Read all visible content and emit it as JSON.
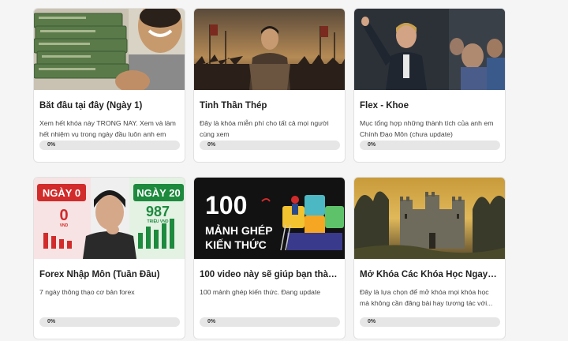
{
  "courses": [
    {
      "title": "Bắt đầu tại đây (Ngày 1)",
      "description": "Xem hết khóa này TRONG NAY. Xem và làm hết nhiệm vụ trong ngày đầu luôn anh em",
      "progress": 0,
      "progress_label": "0%",
      "thumbnail": "money-stacks-photo"
    },
    {
      "title": "Tinh Thần Thép",
      "description": "Đây là khóa miễn phí cho tất cả mọi người cùng xem",
      "progress": 0,
      "progress_label": "0%",
      "thumbnail": "warrior-army-photo"
    },
    {
      "title": "Flex - Khoe",
      "description": "Mục tổng hợp những thành tích của anh em Chính Đạo Môn (chưa update)",
      "progress": 0,
      "progress_label": "0%",
      "thumbnail": "businessman-crowd-photo"
    },
    {
      "title": "Forex Nhập Môn (Tuần Đầu)",
      "description": "7 ngày thông thạo cơ bản forex",
      "progress": 0,
      "progress_label": "0%",
      "thumbnail": "before-after-day-0-day-20",
      "thumb_text": {
        "left_day": "NGÀY 0",
        "left_value": "0",
        "left_unit": "VND",
        "right_day": "NGÀY 20",
        "right_value": "987",
        "right_unit": "TRIỆU VND"
      }
    },
    {
      "title": "100 video này sẽ giúp bạn thành b...",
      "description": "100 mảnh ghép kiến thức. Đang update",
      "progress": 0,
      "progress_label": "0%",
      "thumbnail": "puzzle-100-pieces",
      "thumb_text": {
        "number": "100",
        "line1": "MẢNH GHÉP",
        "line2": "KIẾN THỨC"
      }
    },
    {
      "title": "Mở Khóa Các Khóa Học Ngay Lập ...",
      "description": "Đây là lựa chọn để mở khóa mọi khóa học mà không cần đăng bài hay tương tác với...",
      "progress": 0,
      "progress_label": "0%",
      "thumbnail": "castle-landscape-painting"
    }
  ],
  "colors": {
    "page_bg": "#f5f5f5",
    "card_bg": "#ffffff",
    "progress_track": "#e6e6e6",
    "thumb_green": "#1d8a3e",
    "thumb_red": "#d22b2b",
    "thumb_dark": "#121212"
  }
}
